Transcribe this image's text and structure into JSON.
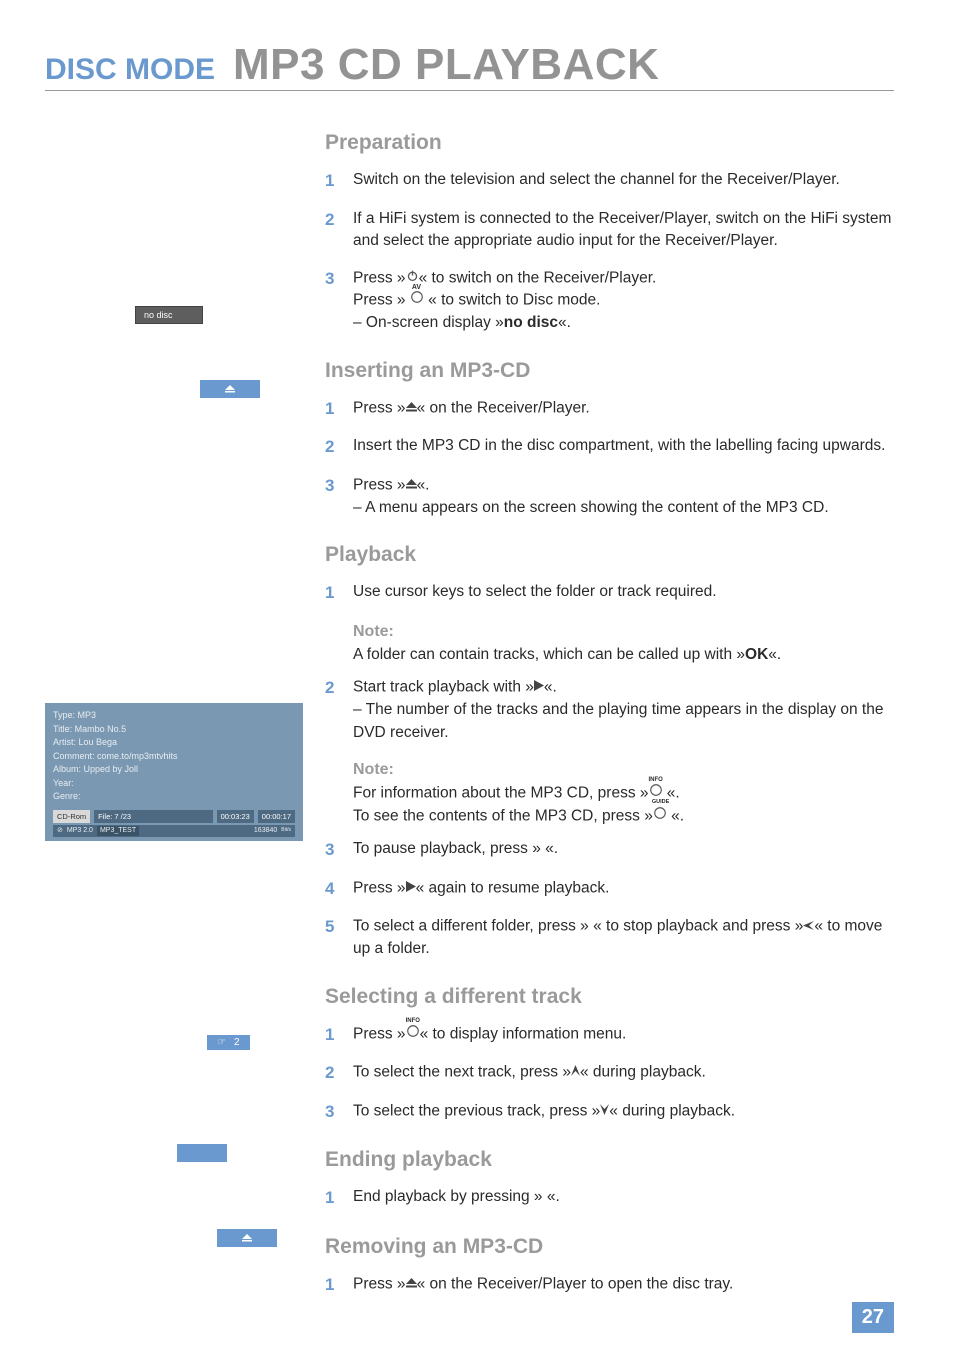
{
  "header": {
    "category": "DISC MODE",
    "title": "MP3 CD PLAYBACK"
  },
  "sidebar": {
    "osd_nodisc": "no disc",
    "eject_glyph": "▲",
    "mp3info": {
      "type": "Type: MP3",
      "title": "Title: Mambo No.5",
      "artist": "Artist: Lou Bega",
      "comment": "Comment: come.to/mp3mtvhits",
      "album": "Album: Upped by Joll",
      "year": "Year:",
      "genre": "Genre:",
      "status": {
        "src": "CD-Rom",
        "file": "File:   7     /23",
        "t1": "00:03:23",
        "t2": "00:00:17"
      },
      "substatus": {
        "icon": "⊘",
        "mp3": "MP3   2.0",
        "test": "MP3_TEST",
        "rate": "163840",
        "unit": "Bit/s"
      }
    },
    "track_widget": {
      "icon": "☞",
      "num": "2"
    }
  },
  "sections": {
    "preparation": {
      "heading": "Preparation",
      "s1": "Switch on the television and select the channel for the Receiver/Player.",
      "s2": "If a HiFi system is connected to the Receiver/Player, switch on the HiFi system and select the appropriate audio input for the Receiver/Player.",
      "s3a": "Press »",
      "s3b": "« to switch on the Receiver/Player.",
      "s3c": "Press » ",
      "s3d": " « to switch to Disc mode.",
      "s3e": "– On-screen display »",
      "s3f": "no disc",
      "s3g": "«."
    },
    "inserting": {
      "heading": "Inserting an MP3-CD",
      "s1a": "Press »",
      "s1b": "« on the Receiver/Player.",
      "s2": "Insert the MP3 CD in the disc compartment, with the labelling facing upwards.",
      "s3a": "Press »",
      "s3b": "«.",
      "s3c": "– A menu appears on the screen showing the content of the MP3 CD."
    },
    "playback": {
      "heading": "Playback",
      "s1": "Use cursor keys to select the folder or track required.",
      "note1_title": "Note:",
      "note1_a": "A folder can contain tracks, which can be called up with »",
      "note1_b": "OK",
      "note1_c": "«.",
      "s2a": "Start track playback with »",
      "s2b": "«.",
      "s2c": "– The number of the tracks and the playing time appears in the display on the DVD receiver.",
      "note2_title": "Note:",
      "note2_a": "For information about the MP3 CD, press »",
      "note2_b": " «.",
      "note2_c": "To see the contents of the MP3 CD, press »",
      "note2_d": " «.",
      "s3": "To pause playback, press »  «.",
      "s4a": "Press »",
      "s4b": "« again to resume playback.",
      "s5a": "To select a different folder, press »  « to stop playback and press »",
      "s5b": "« to move up a folder."
    },
    "selecting": {
      "heading": "Selecting a different track",
      "s1a": "Press »",
      "s1b": "« to display information menu.",
      "s2a": "To select the next track, press »",
      "s2b": "« during playback.",
      "s3a": "To select the previous track, press »",
      "s3b": "« during playback."
    },
    "ending": {
      "heading": "Ending playback",
      "s1": "End playback by pressing »  «."
    },
    "removing": {
      "heading": "Removing an MP3-CD",
      "s1a": "Press »",
      "s1b": "« on the Receiver/Player to open the disc tray."
    }
  },
  "page_number": "27"
}
